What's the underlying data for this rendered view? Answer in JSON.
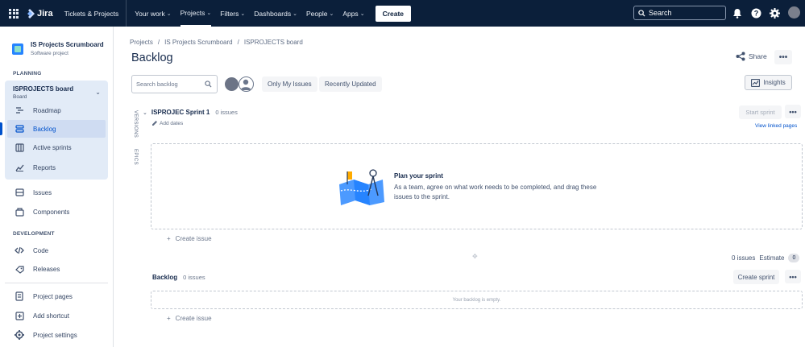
{
  "topnav": {
    "app_name": "Jira",
    "items": [
      {
        "label": "Tickets & Projects"
      },
      {
        "label": "Your work"
      },
      {
        "label": "Projects"
      },
      {
        "label": "Filters"
      },
      {
        "label": "Dashboards"
      },
      {
        "label": "People"
      },
      {
        "label": "Apps"
      }
    ],
    "create_label": "Create",
    "search_placeholder": "Search"
  },
  "sidebar": {
    "project_name": "IS Projects Scrumboard",
    "project_type": "Software project",
    "planning_label": "PLANNING",
    "board_title": "ISPROJECTS board",
    "board_sub": "Board",
    "planning_items": [
      {
        "label": "Roadmap",
        "icon": "roadmap-icon"
      },
      {
        "label": "Backlog",
        "icon": "backlog-icon"
      },
      {
        "label": "Active sprints",
        "icon": "board-icon"
      },
      {
        "label": "Reports",
        "icon": "reports-icon"
      }
    ],
    "other_items": [
      {
        "label": "Issues",
        "icon": "issues-icon"
      },
      {
        "label": "Components",
        "icon": "components-icon"
      }
    ],
    "development_label": "DEVELOPMENT",
    "dev_items": [
      {
        "label": "Code",
        "icon": "code-icon"
      },
      {
        "label": "Releases",
        "icon": "releases-icon"
      }
    ],
    "bottom_items": [
      {
        "label": "Project pages",
        "icon": "pages-icon"
      },
      {
        "label": "Add shortcut",
        "icon": "add-shortcut-icon"
      },
      {
        "label": "Project settings",
        "icon": "settings-icon"
      }
    ]
  },
  "main": {
    "breadcrumb": [
      "Projects",
      "IS Projects Scrumboard",
      "ISPROJECTS board"
    ],
    "breadcrumb_sep": "/",
    "title": "Backlog",
    "share_label": "Share",
    "search_placeholder": "Search backlog",
    "only_my_issues": "Only My Issues",
    "recently_updated": "Recently Updated",
    "insights_label": "Insights",
    "versions_tab": "VERSIONS",
    "epics_tab": "EPICS",
    "sprint": {
      "name": "ISPROJEC Sprint 1",
      "count": "0 issues",
      "add_dates": "Add dates",
      "start_label": "Start sprint",
      "linked_pages": "View linked pages",
      "empty_title": "Plan your sprint",
      "empty_text": "As a team, agree on what work needs to be completed, and drag these issues to the sprint.",
      "create_issue": "Create issue"
    },
    "estimate": {
      "issues": "0 issues",
      "label": "Estimate",
      "value": "0"
    },
    "backlog": {
      "name": "Backlog",
      "count": "0 issues",
      "create_sprint": "Create sprint",
      "empty": "Your backlog is empty.",
      "create_issue": "Create issue"
    }
  },
  "colors": {
    "topnav_bg": "#0b1f3a",
    "accent": "#0052cc",
    "sidebar_group_bg": "#e2ebf7"
  }
}
